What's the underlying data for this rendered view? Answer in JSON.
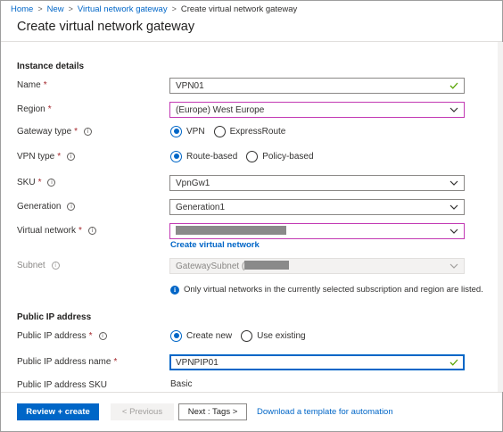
{
  "breadcrumb": {
    "items": [
      "Home",
      "New",
      "Virtual network gateway"
    ],
    "current": "Create virtual network gateway"
  },
  "page": {
    "title": "Create virtual network gateway"
  },
  "instance": {
    "heading": "Instance details",
    "name": {
      "label": "Name",
      "value": "VPN01"
    },
    "region": {
      "label": "Region",
      "value": "(Europe) West Europe"
    },
    "gateway_type": {
      "label": "Gateway type",
      "options": [
        "VPN",
        "ExpressRoute"
      ],
      "selected": "VPN"
    },
    "vpn_type": {
      "label": "VPN type",
      "options": [
        "Route-based",
        "Policy-based"
      ],
      "selected": "Route-based"
    },
    "sku": {
      "label": "SKU",
      "value": "VpnGw1"
    },
    "generation": {
      "label": "Generation",
      "value": "Generation1"
    },
    "virtual_network": {
      "label": "Virtual network",
      "value": "",
      "create_link": "Create virtual network"
    },
    "subnet": {
      "label": "Subnet",
      "value": "GatewaySubnet ("
    },
    "note": "Only virtual networks in the currently selected subscription and region are listed."
  },
  "public_ip": {
    "heading": "Public IP address",
    "address": {
      "label": "Public IP address",
      "options": [
        "Create new",
        "Use existing"
      ],
      "selected": "Create new"
    },
    "name": {
      "label": "Public IP address name",
      "value": "VPNPIP01"
    },
    "sku": {
      "label": "Public IP address SKU",
      "value": "Basic"
    }
  },
  "footer": {
    "review_create": "Review + create",
    "previous": "< Previous",
    "next": "Next : Tags >",
    "download_template": "Download a template for automation"
  },
  "icons": {
    "required_marker": "*",
    "info": "i",
    "valid_check": "check-icon",
    "dropdown": "chevron-down-icon"
  },
  "colors": {
    "accent": "#0066c7",
    "required": "#a4262c",
    "invalid_border": "#c239b3",
    "valid_check": "#57a300"
  }
}
